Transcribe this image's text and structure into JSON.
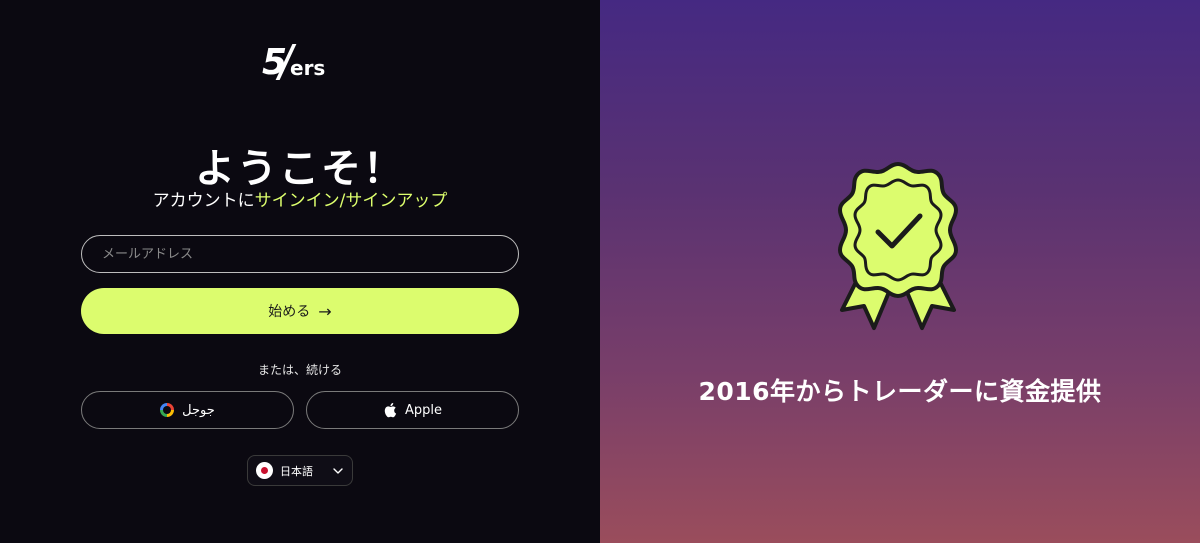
{
  "logo": {
    "five": "5",
    "ers": "ers"
  },
  "welcome": {
    "title": "ようこそ！",
    "subtitle_prefix": "アカウントに",
    "subtitle_accent": "サインイン/サインアップ"
  },
  "email": {
    "placeholder": "メールアドレス",
    "value": ""
  },
  "start_button": {
    "label": "始める",
    "arrow": "→"
  },
  "divider_text": "または、続ける",
  "social": {
    "google_label": "جوجل",
    "apple_label": "Apple"
  },
  "language": {
    "label": "日本語"
  },
  "promo": {
    "tagline": "2016年からトレーダーに資金提供"
  },
  "colors": {
    "accent": "#dcfc6e",
    "background": "#0b0911"
  }
}
